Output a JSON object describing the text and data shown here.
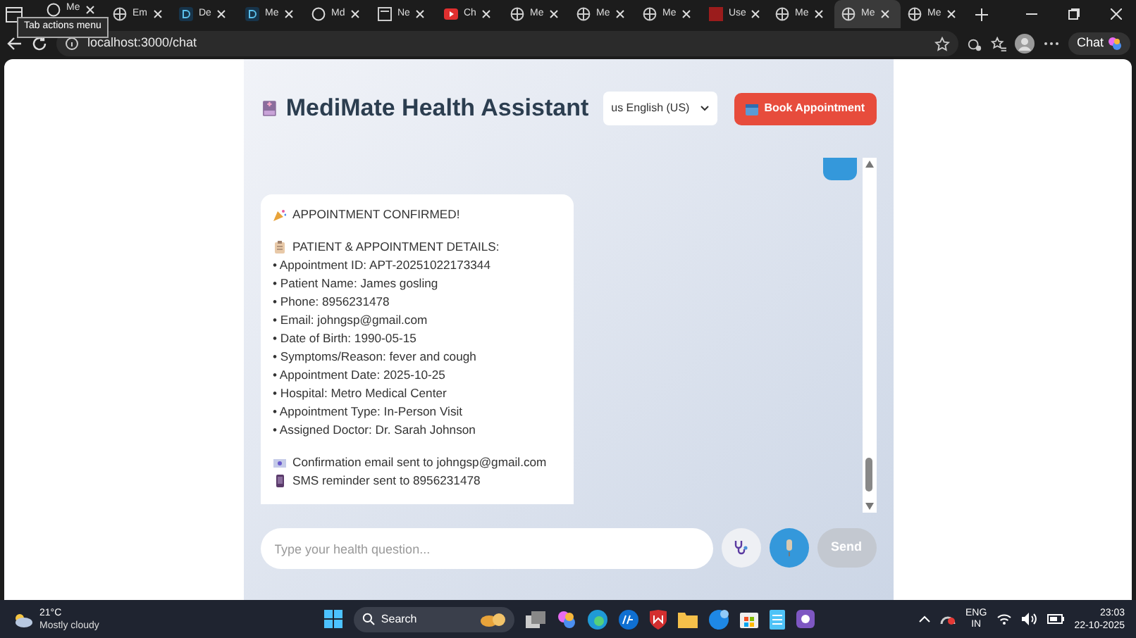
{
  "browser": {
    "tabs": [
      {
        "label": "Me",
        "kind": "github",
        "selected": false
      },
      {
        "label": "Em",
        "kind": "globe",
        "selected": false
      },
      {
        "label": "De",
        "kind": "d",
        "selected": false
      },
      {
        "label": "Me",
        "kind": "d",
        "selected": false
      },
      {
        "label": "Md",
        "kind": "github",
        "selected": false
      },
      {
        "label": "Ne",
        "kind": "page",
        "selected": false
      },
      {
        "label": "Ch",
        "kind": "youtube",
        "selected": false
      },
      {
        "label": "Me",
        "kind": "globe",
        "selected": false
      },
      {
        "label": "Me",
        "kind": "globe",
        "selected": false
      },
      {
        "label": "Me",
        "kind": "globe",
        "selected": false
      },
      {
        "label": "Use",
        "kind": "red",
        "selected": false
      },
      {
        "label": "Me",
        "kind": "globe",
        "selected": false
      },
      {
        "label": "Me",
        "kind": "globe",
        "selected": true
      },
      {
        "label": "Me",
        "kind": "globe",
        "selected": false
      }
    ],
    "tooltip": "Tab actions menu",
    "address": "localhost:3000/chat",
    "chat_button": "Chat"
  },
  "app": {
    "title": "MediMate Health Assistant",
    "language": "us English (US)",
    "book_button": "Book Appointment",
    "messages": [
      {
        "kind": "user"
      },
      {
        "kind": "bot",
        "blocks": [
          [
            {
              "kind": "party",
              "text": "APPOINTMENT CONFIRMED!"
            }
          ],
          [
            {
              "kind": "clipboard",
              "text": "PATIENT & APPOINTMENT DETAILS:"
            },
            {
              "text": "• Appointment ID: APT-20251022173344"
            },
            {
              "text": "• Patient Name: James gosling"
            },
            {
              "text": "• Phone: 8956231478"
            },
            {
              "text": "• Email: johngsp@gmail.com"
            },
            {
              "text": "• Date of Birth: 1990-05-15"
            },
            {
              "text": "• Symptoms/Reason: fever and cough"
            },
            {
              "text": "• Appointment Date: 2025-10-25"
            },
            {
              "text": "• Hospital: Metro Medical Center"
            },
            {
              "text": "• Appointment Type: In-Person Visit"
            },
            {
              "text": "• Assigned Doctor: Dr. Sarah Johnson"
            }
          ],
          [
            {
              "kind": "envelope",
              "text": "Confirmation email sent to johngsp@gmail.com"
            },
            {
              "kind": "phone",
              "text": "SMS reminder sent to 8956231478"
            }
          ]
        ]
      }
    ],
    "input_placeholder": "Type your health question...",
    "send_button": "Send",
    "send_disabled": true
  },
  "taskbar": {
    "temperature": "21°C",
    "weather": "Mostly cloudy",
    "search": "Search",
    "lang": "ENG",
    "region": "IN",
    "time": "23:03",
    "date": "22-10-2025"
  }
}
